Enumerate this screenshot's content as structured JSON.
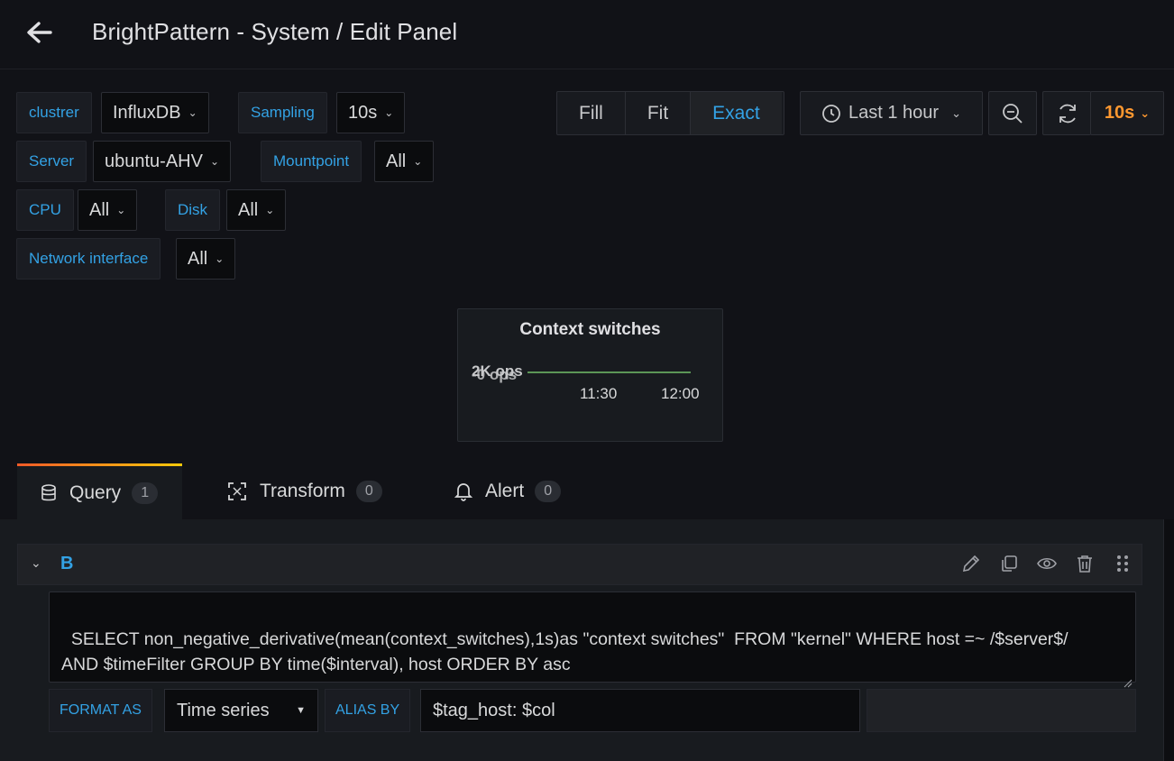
{
  "header": {
    "title": "BrightPattern - System / Edit Panel"
  },
  "variables": {
    "cluster": {
      "label": "clustrer",
      "value": "InfluxDB"
    },
    "sampling": {
      "label": "Sampling",
      "value": "10s"
    },
    "server": {
      "label": "Server",
      "value": "ubuntu-AHV"
    },
    "mountpoint": {
      "label": "Mountpoint",
      "value": "All"
    },
    "cpu": {
      "label": "CPU",
      "value": "All"
    },
    "disk": {
      "label": "Disk",
      "value": "All"
    },
    "network": {
      "label": "Network interface",
      "value": "All"
    }
  },
  "toolbar": {
    "fill": "Fill",
    "fit": "Fit",
    "exact": "Exact",
    "time_range": "Last 1 hour",
    "refresh_interval": "10s"
  },
  "panel": {
    "title": "Context switches",
    "y_label_top": "2K ops",
    "y_label_bottom": "-0 ops",
    "x_ticks": [
      "11:30",
      "12:00"
    ]
  },
  "tabs": {
    "query": {
      "label": "Query",
      "count": "1"
    },
    "transform": {
      "label": "Transform",
      "count": "0"
    },
    "alert": {
      "label": "Alert",
      "count": "0"
    }
  },
  "query": {
    "ref_id": "B",
    "text": "SELECT non_negative_derivative(mean(context_switches),1s)as \"context switches\"  FROM \"kernel\" WHERE host =~ /$server$/\nAND $timeFilter GROUP BY time($interval), host ORDER BY asc",
    "format_label": "FORMAT AS",
    "format_value": "Time series",
    "alias_label": "ALIAS BY",
    "alias_value": "$tag_host: $col"
  },
  "colors": {
    "accent": "#33a2e5",
    "refresh": "#ff9830",
    "series": "#73bf69"
  }
}
